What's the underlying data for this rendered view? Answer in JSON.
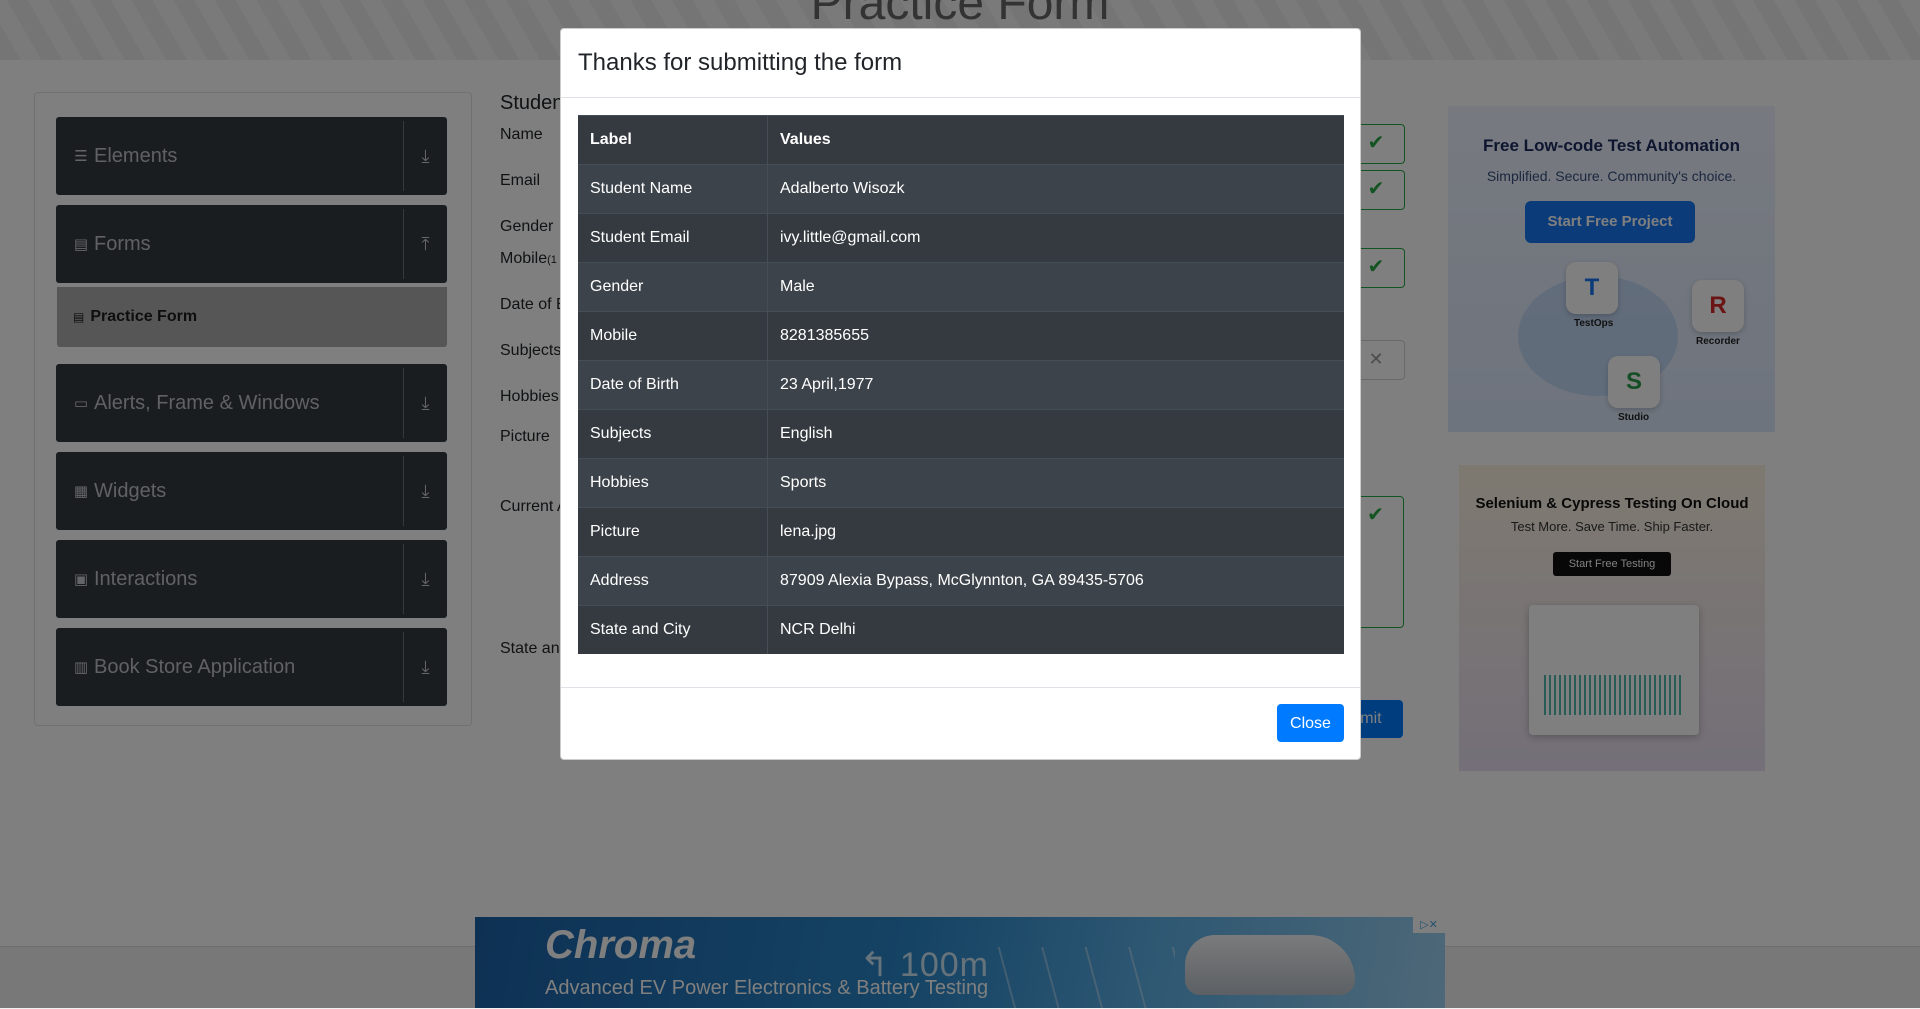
{
  "page": {
    "title": "Practice Form",
    "section_label": "Student Registration Form"
  },
  "sidebar": {
    "groups": [
      {
        "label": "Elements",
        "icon": "list-icon"
      },
      {
        "label": "Forms",
        "icon": "document-icon"
      },
      {
        "label": "Alerts, Frame & Windows",
        "icon": "window-icon"
      },
      {
        "label": "Widgets",
        "icon": "grid-icon"
      },
      {
        "label": "Interactions",
        "icon": "interaction-icon"
      },
      {
        "label": "Book Store Application",
        "icon": "books-icon"
      }
    ],
    "active_item": "Practice Form"
  },
  "form": {
    "labels": {
      "name": "Name",
      "email": "Email",
      "gender": "Gender",
      "mobile": "Mobile",
      "mobile_hint": "(1",
      "dob": "Date of B",
      "subjects": "Subjects",
      "hobbies": "Hobbies",
      "picture": "Picture",
      "current_address": "Current A",
      "state_city": "State an"
    },
    "submit_label": "Submit",
    "submit_visible": "bmit"
  },
  "ads": {
    "right_1": {
      "headline": "Free Low-code Test Automation",
      "sub": "Simplified. Secure. Community's choice.",
      "button": "Start Free Project",
      "tiles": [
        "TestOps",
        "Recorder",
        "Studio"
      ]
    },
    "right_2": {
      "headline": "Selenium & Cypress Testing On Cloud",
      "sub": "Test More. Save Time. Ship Faster.",
      "button": "Start Free Testing"
    },
    "bottom": {
      "brand": "Chroma",
      "distance": "100m",
      "tagline": "Advanced EV Power Electronics & Battery Testing"
    }
  },
  "modal": {
    "title": "Thanks for submitting the form",
    "table": {
      "headers": [
        "Label",
        "Values"
      ],
      "rows": [
        [
          "Student Name",
          "Adalberto Wisozk"
        ],
        [
          "Student Email",
          "ivy.little@gmail.com"
        ],
        [
          "Gender",
          "Male"
        ],
        [
          "Mobile",
          "8281385655"
        ],
        [
          "Date of Birth",
          "23 April,1977"
        ],
        [
          "Subjects",
          "English"
        ],
        [
          "Hobbies",
          "Sports"
        ],
        [
          "Picture",
          "lena.jpg"
        ],
        [
          "Address",
          "87909 Alexia Bypass, McGlynnton, GA 89435-5706"
        ],
        [
          "State and City",
          "NCR Delhi"
        ]
      ]
    },
    "close_label": "Close"
  },
  "colors": {
    "primary": "#007bff",
    "dark": "#343a40",
    "success": "#28a745",
    "overlay": "rgba(0,0,0,0.5)"
  }
}
